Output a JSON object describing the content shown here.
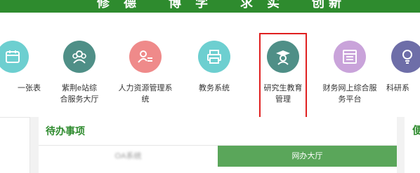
{
  "banner": {
    "motto_chars": [
      "修",
      "德",
      "博",
      "学",
      "求",
      "实",
      "创",
      "新"
    ]
  },
  "apps": [
    {
      "label": "一张表",
      "icon": "calendar-icon",
      "color": "#6dcfd0"
    },
    {
      "label": "紫荆e站综合服务大厅",
      "icon": "people-group-icon",
      "color": "#4f8f87"
    },
    {
      "label": "人力资源管理系统",
      "icon": "user-list-icon",
      "color": "#ef8a8a"
    },
    {
      "label": "教务系统",
      "icon": "printer-icon",
      "color": "#6dcfd0"
    },
    {
      "label": "研究生教育管理",
      "icon": "graduate-cap-icon",
      "color": "#4f8f87"
    },
    {
      "label": "财务网上综合服务平台",
      "icon": "document-window-icon",
      "color": "#c9a3da"
    },
    {
      "label": "科研系",
      "icon": "lightbulb-icon",
      "color": "#6e6ea8"
    }
  ],
  "pending": {
    "title": "待办事项",
    "tab_left": "OA系统",
    "tab_right": "网办大厅"
  },
  "right_panel": {
    "title_char": "便"
  }
}
